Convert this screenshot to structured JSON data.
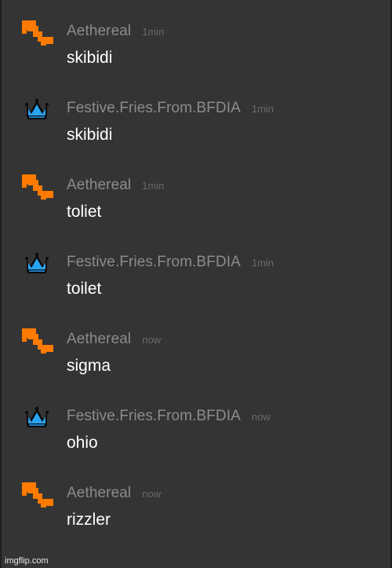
{
  "chat": {
    "messages": [
      {
        "user": "Aethereal",
        "time": "1min",
        "text": "skibidi",
        "avatar": "orange-pixel-arrow-icon"
      },
      {
        "user": "Festive.Fries.From.BFDIA",
        "time": "1min",
        "text": "skibidi",
        "avatar": "blue-crown-icon"
      },
      {
        "user": "Aethereal",
        "time": "1min",
        "text": "toliet",
        "avatar": "orange-pixel-arrow-icon"
      },
      {
        "user": "Festive.Fries.From.BFDIA",
        "time": "1min",
        "text": "toilet",
        "avatar": "blue-crown-icon"
      },
      {
        "user": "Aethereal",
        "time": "now",
        "text": "sigma",
        "avatar": "orange-pixel-arrow-icon"
      },
      {
        "user": "Festive.Fries.From.BFDIA",
        "time": "now",
        "text": "ohio",
        "avatar": "blue-crown-icon"
      },
      {
        "user": "Aethereal",
        "time": "now",
        "text": "rizzler",
        "avatar": "orange-pixel-arrow-icon"
      }
    ]
  },
  "watermark": "imgflip.com",
  "colors": {
    "background": "#343434",
    "username": "#8c8c8c",
    "timestamp": "#6a6a6a",
    "message_text": "#ffffff",
    "arrow_orange": "#ff7a00",
    "crown_blue": "#2aa3f0"
  }
}
